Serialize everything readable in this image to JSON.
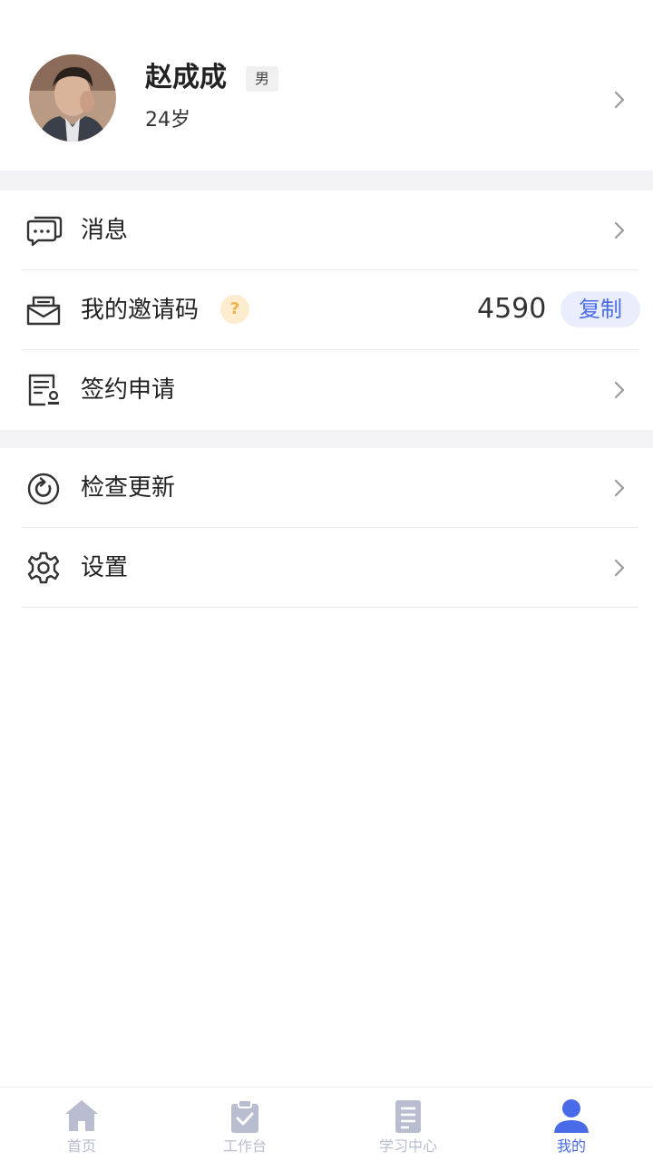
{
  "profile": {
    "name": "赵成成",
    "gender": "男",
    "age": "24岁"
  },
  "menu_group_1": [
    {
      "label": "消息",
      "icon": "message-icon"
    },
    {
      "label": "我的邀请码",
      "icon": "invite-icon",
      "help": "?",
      "code": "4590",
      "copy_label": "复制"
    },
    {
      "label": "签约申请",
      "icon": "contract-icon"
    }
  ],
  "menu_group_2": [
    {
      "label": "检查更新",
      "icon": "refresh-icon"
    },
    {
      "label": "设置",
      "icon": "gear-icon"
    }
  ],
  "tabbar": [
    {
      "label": "首页",
      "icon": "home-icon",
      "active": false
    },
    {
      "label": "工作台",
      "icon": "clipboard-icon",
      "active": false
    },
    {
      "label": "学习中心",
      "icon": "document-icon",
      "active": false
    },
    {
      "label": "我的",
      "icon": "person-icon",
      "active": true
    }
  ],
  "colors": {
    "accent": "#4a6be8",
    "tab_inactive": "#b8bdd0",
    "section_gap": "#f3f3f5",
    "help_badge_bg": "#fdeccd",
    "help_badge_fg": "#f0b34a"
  }
}
